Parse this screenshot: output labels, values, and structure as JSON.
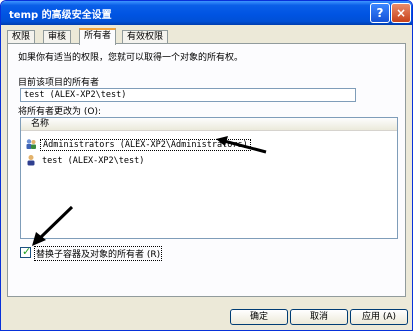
{
  "window": {
    "title": "temp 的高级安全设置",
    "help_label": "?",
    "close_label": "×"
  },
  "tabs": [
    {
      "label": "权限"
    },
    {
      "label": "审核"
    },
    {
      "label": "所有者"
    },
    {
      "label": "有效权限"
    }
  ],
  "owner_tab": {
    "description": "如果你有适当的权限，您就可以取得一个对象的所有权。",
    "current_owner_label": "目前该项目的所有者",
    "current_owner_value": "test (ALEX-XP2\\test)",
    "change_to_label": "将所有者更改为 (O):",
    "list_header": "名称",
    "owners": [
      {
        "name": "Administrators (ALEX-XP2\\Administrators)",
        "icon": "group-users-icon"
      },
      {
        "name": "test (ALEX-XP2\\test)",
        "icon": "user-icon"
      }
    ],
    "replace_checkbox_label": "替换子容器及对象的所有者 (R)",
    "replace_checked": true
  },
  "buttons": {
    "ok": "确定",
    "cancel": "取消",
    "apply": "应用 (A)"
  },
  "colors": {
    "titlebar": "#0054e3",
    "dialog_bg": "#ece9d8",
    "tab_highlight": "#f1a33c",
    "annotation_arrow": "#000000"
  }
}
